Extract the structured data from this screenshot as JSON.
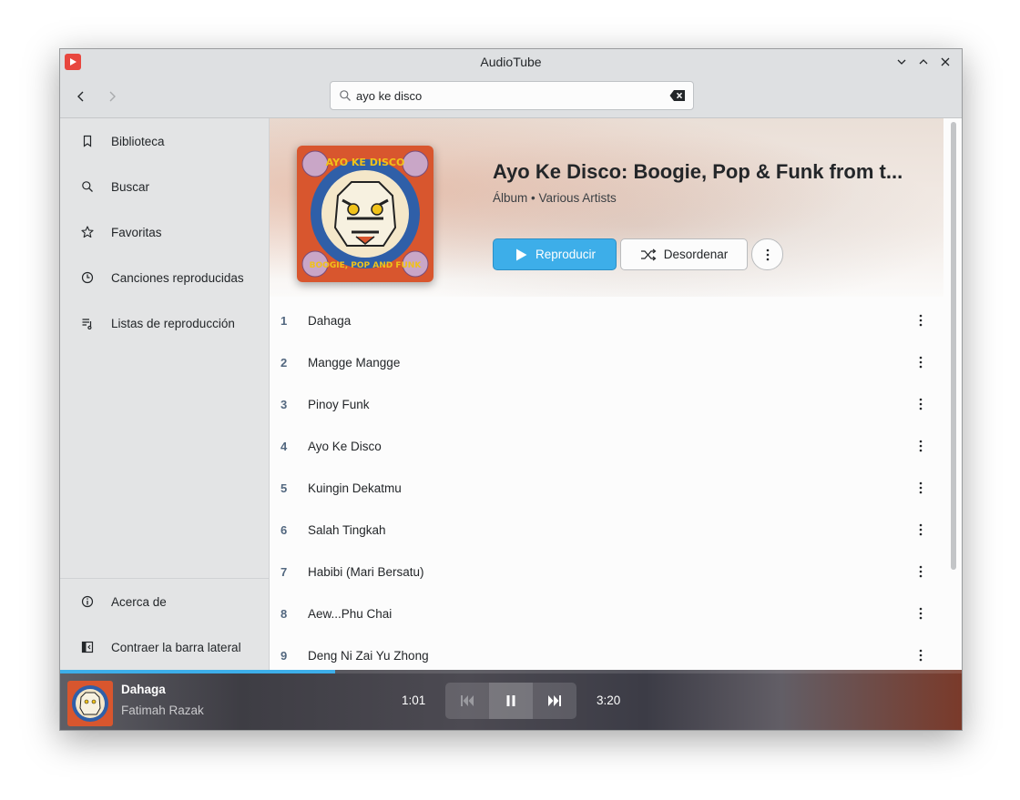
{
  "window": {
    "title": "AudioTube"
  },
  "search": {
    "value": "ayo ke disco"
  },
  "sidebar": {
    "items": [
      {
        "label": "Biblioteca",
        "icon": "bookmark-icon"
      },
      {
        "label": "Buscar",
        "icon": "search-icon"
      },
      {
        "label": "Favoritas",
        "icon": "star-icon"
      },
      {
        "label": "Canciones reproducidas",
        "icon": "history-icon"
      },
      {
        "label": "Listas de reproducción",
        "icon": "playlist-icon"
      }
    ],
    "bottom": [
      {
        "label": "Acerca de",
        "icon": "info-icon"
      },
      {
        "label": "Contraer la barra lateral",
        "icon": "sidebar-collapse-icon"
      }
    ]
  },
  "album": {
    "title": "Ayo Ke Disco: Boogie, Pop & Funk from t...",
    "subtitle": "Álbum • Various Artists",
    "cover_text_top": "AYO KE DISCO",
    "cover_text_bottom": "BOOGIE, POP AND FUNK",
    "play_label": "Reproducir",
    "shuffle_label": "Desordenar"
  },
  "tracks": [
    {
      "num": "1",
      "title": "Dahaga"
    },
    {
      "num": "2",
      "title": "Mangge Mangge"
    },
    {
      "num": "3",
      "title": "Pinoy Funk"
    },
    {
      "num": "4",
      "title": "Ayo Ke Disco"
    },
    {
      "num": "5",
      "title": "Kuingin Dekatmu"
    },
    {
      "num": "6",
      "title": "Salah Tingkah"
    },
    {
      "num": "7",
      "title": "Habibi (Mari Bersatu)"
    },
    {
      "num": "8",
      "title": "Aew...Phu Chai"
    },
    {
      "num": "9",
      "title": "Deng Ni Zai Yu Zhong"
    }
  ],
  "player": {
    "title": "Dahaga",
    "artist": "Fatimah Razak",
    "elapsed": "1:01",
    "duration": "3:20",
    "progress_fraction": 0.305
  },
  "colors": {
    "accent": "#3daee9",
    "app_icon": "#e8473f"
  }
}
